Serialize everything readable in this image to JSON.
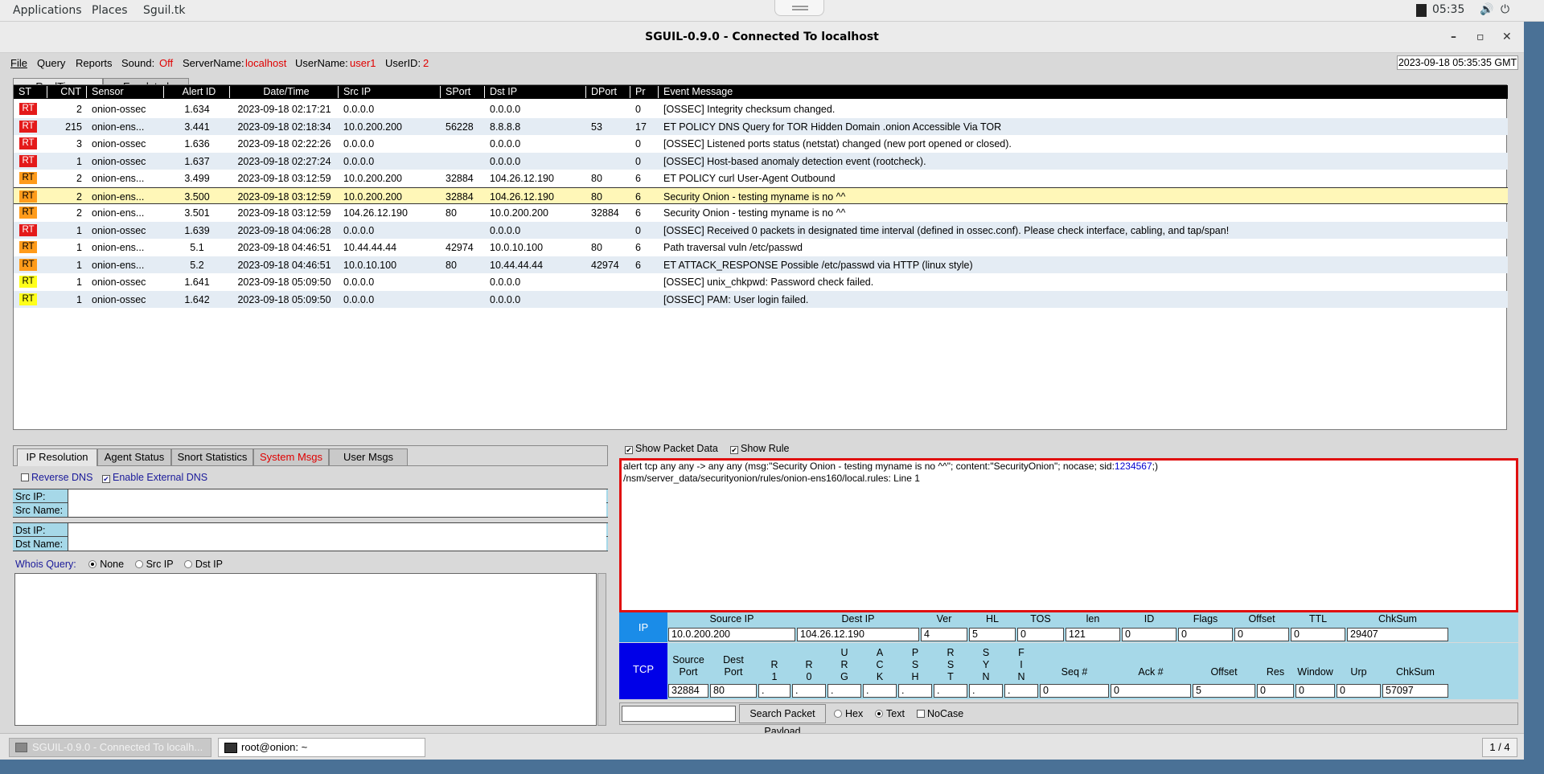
{
  "desktop": {
    "menus": [
      "Applications",
      "Places",
      "Sguil.tk"
    ],
    "clock": "05:35"
  },
  "window": {
    "title": "SGUIL-0.9.0 - Connected To localhost",
    "minimize": "–",
    "maximize": "▫",
    "close": "✕"
  },
  "menubar": {
    "file": "File",
    "query": "Query",
    "reports": "Reports",
    "sound_label": "Sound:",
    "sound_value": "Off",
    "server_label": "ServerName:",
    "server_value": "localhost",
    "user_label": "UserName:",
    "user_value": "user1",
    "userid_label": "UserID:",
    "userid_value": "2",
    "timestamp": "2023-09-18 05:35:35 GMT"
  },
  "event_tabs": [
    "RealTime Events",
    "Escalated Events"
  ],
  "columns": [
    "ST",
    "CNT",
    "Sensor",
    "Alert ID",
    "Date/Time",
    "Src IP",
    "SPort",
    "Dst IP",
    "DPort",
    "Pr",
    "Event Message"
  ],
  "events": [
    {
      "st": "RT",
      "color": "red",
      "cnt": "2",
      "sensor": "onion-ossec",
      "alert": "1.634",
      "dt": "2023-09-18 02:17:21",
      "src": "0.0.0.0",
      "sport": "",
      "dst": "0.0.0.0",
      "dport": "",
      "pr": "0",
      "msg": "[OSSEC] Integrity checksum changed."
    },
    {
      "st": "RT",
      "color": "red",
      "cnt": "215",
      "sensor": "onion-ens...",
      "alert": "3.441",
      "dt": "2023-09-18 02:18:34",
      "src": "10.0.200.200",
      "sport": "56228",
      "dst": "8.8.8.8",
      "dport": "53",
      "pr": "17",
      "msg": "ET POLICY DNS Query for TOR Hidden Domain .onion Accessible Via TOR"
    },
    {
      "st": "RT",
      "color": "red",
      "cnt": "3",
      "sensor": "onion-ossec",
      "alert": "1.636",
      "dt": "2023-09-18 02:22:26",
      "src": "0.0.0.0",
      "sport": "",
      "dst": "0.0.0.0",
      "dport": "",
      "pr": "0",
      "msg": "[OSSEC] Listened ports status (netstat) changed (new port opened or closed)."
    },
    {
      "st": "RT",
      "color": "red",
      "cnt": "1",
      "sensor": "onion-ossec",
      "alert": "1.637",
      "dt": "2023-09-18 02:27:24",
      "src": "0.0.0.0",
      "sport": "",
      "dst": "0.0.0.0",
      "dport": "",
      "pr": "0",
      "msg": "[OSSEC] Host-based anomaly detection event (rootcheck)."
    },
    {
      "st": "RT",
      "color": "orange",
      "cnt": "2",
      "sensor": "onion-ens...",
      "alert": "3.499",
      "dt": "2023-09-18 03:12:59",
      "src": "10.0.200.200",
      "sport": "32884",
      "dst": "104.26.12.190",
      "dport": "80",
      "pr": "6",
      "msg": "ET POLICY curl User-Agent Outbound"
    },
    {
      "st": "RT",
      "color": "orange",
      "cnt": "2",
      "sensor": "onion-ens...",
      "alert": "3.500",
      "dt": "2023-09-18 03:12:59",
      "src": "10.0.200.200",
      "sport": "32884",
      "dst": "104.26.12.190",
      "dport": "80",
      "pr": "6",
      "msg": "Security Onion - testing myname is no ^^"
    },
    {
      "st": "RT",
      "color": "orange",
      "cnt": "2",
      "sensor": "onion-ens...",
      "alert": "3.501",
      "dt": "2023-09-18 03:12:59",
      "src": "104.26.12.190",
      "sport": "80",
      "dst": "10.0.200.200",
      "dport": "32884",
      "pr": "6",
      "msg": "Security Onion - testing myname is no ^^"
    },
    {
      "st": "RT",
      "color": "red",
      "cnt": "1",
      "sensor": "onion-ossec",
      "alert": "1.639",
      "dt": "2023-09-18 04:06:28",
      "src": "0.0.0.0",
      "sport": "",
      "dst": "0.0.0.0",
      "dport": "",
      "pr": "0",
      "msg": "[OSSEC] Received 0 packets in designated time interval (defined in ossec.conf).  Please check interface, cabling, and tap/span!"
    },
    {
      "st": "RT",
      "color": "orange",
      "cnt": "1",
      "sensor": "onion-ens...",
      "alert": "5.1",
      "dt": "2023-09-18 04:46:51",
      "src": "10.44.44.44",
      "sport": "42974",
      "dst": "10.0.10.100",
      "dport": "80",
      "pr": "6",
      "msg": "Path traversal vuln /etc/passwd"
    },
    {
      "st": "RT",
      "color": "orange",
      "cnt": "1",
      "sensor": "onion-ens...",
      "alert": "5.2",
      "dt": "2023-09-18 04:46:51",
      "src": "10.0.10.100",
      "sport": "80",
      "dst": "10.44.44.44",
      "dport": "42974",
      "pr": "6",
      "msg": "ET ATTACK_RESPONSE Possible /etc/passwd via HTTP (linux style)"
    },
    {
      "st": "RT",
      "color": "yellow",
      "cnt": "1",
      "sensor": "onion-ossec",
      "alert": "1.641",
      "dt": "2023-09-18 05:09:50",
      "src": "0.0.0.0",
      "sport": "",
      "dst": "0.0.0.0",
      "dport": "",
      "pr": "",
      "msg": "[OSSEC] unix_chkpwd: Password check failed."
    },
    {
      "st": "RT",
      "color": "yellow",
      "cnt": "1",
      "sensor": "onion-ossec",
      "alert": "1.642",
      "dt": "2023-09-18 05:09:50",
      "src": "0.0.0.0",
      "sport": "",
      "dst": "0.0.0.0",
      "dport": "",
      "pr": "",
      "msg": "[OSSEC] PAM: User login failed."
    }
  ],
  "selected_event_index": 5,
  "lower_tabs": [
    "IP Resolution",
    "Agent Status",
    "Snort Statistics",
    "System Msgs",
    "User Msgs"
  ],
  "ipres": {
    "reverse_dns": "Reverse DNS",
    "external_dns": "Enable External DNS",
    "src_ip": "Src IP:",
    "src_name": "Src Name:",
    "dst_ip": "Dst IP:",
    "dst_name": "Dst Name:",
    "whois": "Whois Query:",
    "opt_none": "None",
    "opt_src": "Src IP",
    "opt_dst": "Dst IP"
  },
  "packet": {
    "show_packet_data": "Show Packet Data",
    "show_rule": "Show Rule",
    "rule_pre": "alert tcp any any -> any any (msg:\"Security Onion - testing myname is no ^^\"; content:\"SecurityOnion\"; nocase; sid:",
    "rule_sid": "1234567",
    "rule_post": ";)",
    "rule_file": "/nsm/server_data/securityonion/rules/onion-ens160/local.rules: Line 1"
  },
  "ip_header": {
    "tag": "IP",
    "labels": [
      "Source IP",
      "Dest IP",
      "Ver",
      "HL",
      "TOS",
      "len",
      "ID",
      "Flags",
      "Offset",
      "TTL",
      "ChkSum"
    ],
    "values": [
      "10.0.200.200",
      "104.26.12.190",
      "4",
      "5",
      "0",
      "121",
      "0",
      "0",
      "0",
      "0",
      "29407"
    ]
  },
  "tcp_header": {
    "tag": "TCP",
    "labels": [
      "Source Port",
      "Dest Port",
      "R 1",
      "R 0",
      "U R G",
      "A C K",
      "P S H",
      "R S T",
      "S Y N",
      "F I N",
      "Seq #",
      "Ack #",
      "Offset",
      "Res",
      "Window",
      "Urp",
      "ChkSum"
    ],
    "values": [
      "32884",
      "80",
      ".",
      ".",
      ".",
      ".",
      ".",
      ".",
      ".",
      ".",
      "0",
      "0",
      "5",
      "0",
      "0",
      "0",
      "57097"
    ]
  },
  "search": {
    "button": "Search Packet Payload",
    "hex": "Hex",
    "text": "Text",
    "nocase": "NoCase"
  },
  "taskbar": {
    "task1": "SGUIL-0.9.0 - Connected To localh...",
    "task2": "root@onion: ~",
    "workspace": "1 / 4"
  },
  "colors": {
    "red": "#e41a1a",
    "orange": "#ff9b1a",
    "yellow": "#ffff1a",
    "highlight": "#e01010",
    "header_bg": "#a6d8e8",
    "tag_bg": "#0000e8"
  }
}
